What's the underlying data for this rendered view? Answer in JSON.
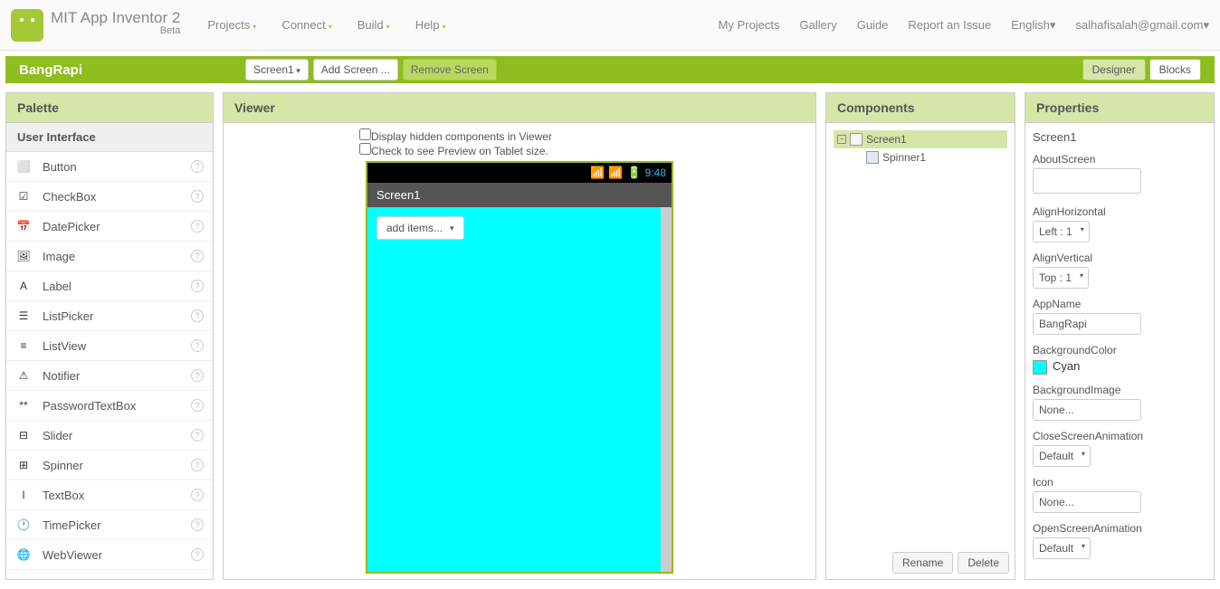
{
  "header": {
    "app_title": "MIT App Inventor 2",
    "beta": "Beta",
    "menu": [
      "Projects",
      "Connect",
      "Build",
      "Help"
    ],
    "right_menu": [
      "My Projects",
      "Gallery",
      "Guide",
      "Report an Issue",
      "English",
      "salhafisalah@gmail.com"
    ]
  },
  "green_bar": {
    "project_name": "BangRapi",
    "screen_selector": "Screen1",
    "add_screen": "Add Screen ...",
    "remove_screen": "Remove Screen",
    "designer": "Designer",
    "blocks": "Blocks"
  },
  "palette": {
    "title": "Palette",
    "section": "User Interface",
    "items": [
      {
        "label": "Button",
        "icon": "⬜"
      },
      {
        "label": "CheckBox",
        "icon": "☑"
      },
      {
        "label": "DatePicker",
        "icon": "📅"
      },
      {
        "label": "Image",
        "icon": "🖼"
      },
      {
        "label": "Label",
        "icon": "A"
      },
      {
        "label": "ListPicker",
        "icon": "☰"
      },
      {
        "label": "ListView",
        "icon": "≡"
      },
      {
        "label": "Notifier",
        "icon": "⚠"
      },
      {
        "label": "PasswordTextBox",
        "icon": "**"
      },
      {
        "label": "Slider",
        "icon": "⊟"
      },
      {
        "label": "Spinner",
        "icon": "⊞"
      },
      {
        "label": "TextBox",
        "icon": "I"
      },
      {
        "label": "TimePicker",
        "icon": "🕐"
      },
      {
        "label": "WebViewer",
        "icon": "🌐"
      }
    ]
  },
  "viewer": {
    "title": "Viewer",
    "opt1": "Display hidden components in Viewer",
    "opt2": "Check to see Preview on Tablet size.",
    "status_time": "9:48",
    "screen_title": "Screen1",
    "spinner_text": "add items..."
  },
  "components": {
    "title": "Components",
    "root": "Screen1",
    "child": "Spinner1",
    "rename": "Rename",
    "delete": "Delete"
  },
  "properties": {
    "title": "Properties",
    "component": "Screen1",
    "items": [
      {
        "label": "AboutScreen",
        "type": "textarea",
        "value": ""
      },
      {
        "label": "AlignHorizontal",
        "type": "select",
        "value": "Left : 1"
      },
      {
        "label": "AlignVertical",
        "type": "select",
        "value": "Top : 1"
      },
      {
        "label": "AppName",
        "type": "input",
        "value": "BangRapi"
      },
      {
        "label": "BackgroundColor",
        "type": "color",
        "value": "Cyan",
        "color": "#00ffff"
      },
      {
        "label": "BackgroundImage",
        "type": "input",
        "value": "None..."
      },
      {
        "label": "CloseScreenAnimation",
        "type": "select",
        "value": "Default"
      },
      {
        "label": "Icon",
        "type": "input",
        "value": "None..."
      },
      {
        "label": "OpenScreenAnimation",
        "type": "select",
        "value": "Default"
      }
    ]
  }
}
